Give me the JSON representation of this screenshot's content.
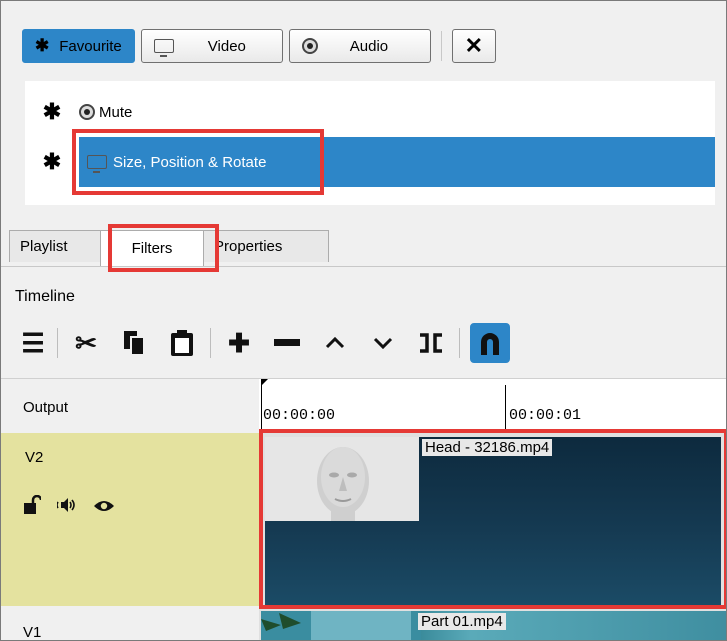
{
  "categories": {
    "favourite": "Favourite",
    "video": "Video",
    "audio": "Audio"
  },
  "filters": [
    {
      "name": "Mute",
      "favourite_icon": "asterisk-icon",
      "type_icon": "audio-icon"
    },
    {
      "name": "Size, Position & Rotate",
      "favourite_icon": "asterisk-icon",
      "type_icon": "monitor-icon",
      "selected": true
    }
  ],
  "tabs": [
    "Playlist",
    "Filters",
    "Properties"
  ],
  "active_tab": "Filters",
  "timeline": {
    "title": "Timeline",
    "toolbar_icons": [
      "menu-icon",
      "cut-icon",
      "copy-icon",
      "paste-icon",
      "append-icon",
      "remove-icon",
      "lift-icon",
      "overwrite-icon",
      "split-icon",
      "snap-icon"
    ],
    "output_label": "Output",
    "ruler": [
      "00:00:00",
      "00:00:01"
    ],
    "tracks": [
      {
        "name": "V2",
        "clip": "Head - 32186.mp4"
      },
      {
        "name": "V1",
        "clip": "Part 01.mp4"
      }
    ]
  },
  "colors": {
    "accent": "#2d86c8",
    "highlight": "#e53935",
    "track_header_selected": "#e4e29f",
    "clip": "#153a52"
  }
}
